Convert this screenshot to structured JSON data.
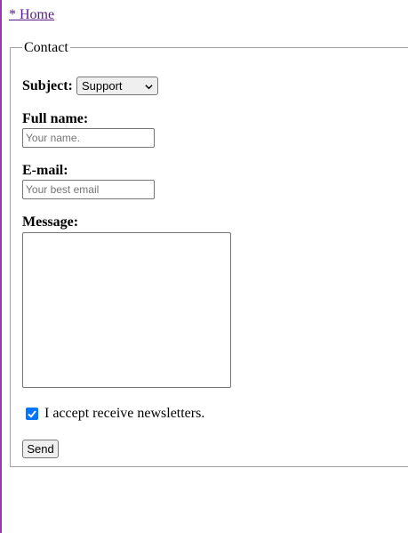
{
  "nav": {
    "home_link": "* Home"
  },
  "form": {
    "legend": "Contact",
    "subject": {
      "label": "Subject:",
      "selected": "Support"
    },
    "full_name": {
      "label": "Full name:",
      "value": "",
      "placeholder": "Your name."
    },
    "email": {
      "label": "E-mail:",
      "value": "",
      "placeholder": "Your best email"
    },
    "message": {
      "label": "Message:",
      "value": ""
    },
    "newsletter": {
      "checked": true,
      "label": "I accept receive newsletters."
    },
    "send_label": "Send"
  },
  "colors": {
    "link": "#551a8b",
    "checkbox_accent": "#0075ff",
    "page_left_rule": "#9b34b8"
  }
}
